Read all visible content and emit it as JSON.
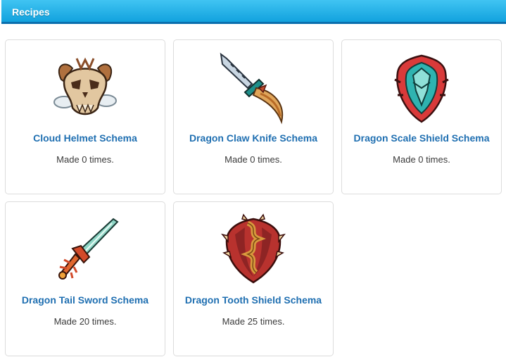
{
  "header": {
    "title": "Recipes",
    "color": "#1aa7e2"
  },
  "recipes": [
    {
      "name": "Cloud Helmet Schema",
      "made": "Made 0 times.",
      "icon": "helmet-icon"
    },
    {
      "name": "Dragon Claw Knife Schema",
      "made": "Made 0 times.",
      "icon": "knife-icon"
    },
    {
      "name": "Dragon Scale Shield Schema",
      "made": "Made 0 times.",
      "icon": "shield-icon"
    },
    {
      "name": "Dragon Tail Sword Schema",
      "made": "Made 20 times.",
      "icon": "sword-icon"
    },
    {
      "name": "Dragon Tooth Shield Schema",
      "made": "Made 25 times.",
      "icon": "tooth-shield-icon"
    }
  ],
  "colors": {
    "link": "#1f6fb1",
    "text": "#3a3a3a",
    "border": "#dcdcdc"
  }
}
